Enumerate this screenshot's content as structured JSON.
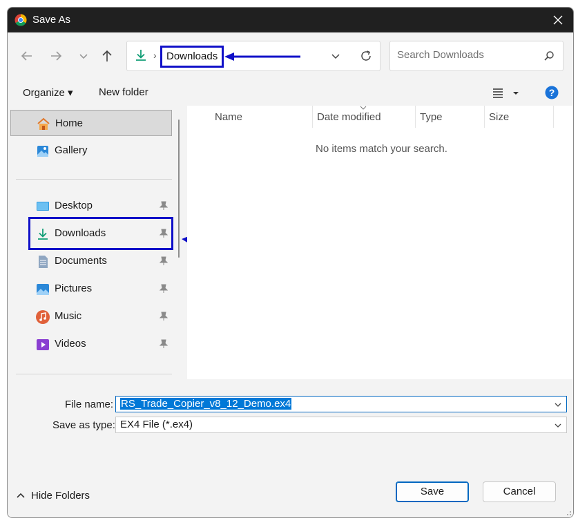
{
  "titlebar": {
    "title": "Save As",
    "app_icon": "chrome-logo",
    "close_icon": "close-icon"
  },
  "nav": {
    "back_icon": "back-arrow-icon",
    "forward_icon": "forward-arrow-icon",
    "recent_icon": "chevron-down-icon",
    "up_icon": "up-arrow-icon"
  },
  "address": {
    "location_icon": "download-icon",
    "separator": "›",
    "crumb": "Downloads",
    "dropdown_icon": "chevron-down-icon",
    "refresh_icon": "refresh-icon"
  },
  "search": {
    "placeholder": "Search Downloads",
    "icon": "search-icon"
  },
  "toolbar": {
    "organize": "Organize ▾",
    "new_folder": "New folder",
    "view_icon": "view-options-icon",
    "help_icon": "help-icon"
  },
  "sidebar": {
    "items": [
      {
        "label": "Home",
        "icon": "home-icon",
        "pinned": false,
        "selected": true
      },
      {
        "label": "Gallery",
        "icon": "gallery-icon",
        "pinned": false
      },
      {
        "label": "Desktop",
        "icon": "desktop-icon",
        "pinned": true
      },
      {
        "label": "Downloads",
        "icon": "download-icon",
        "pinned": true
      },
      {
        "label": "Documents",
        "icon": "documents-icon",
        "pinned": true
      },
      {
        "label": "Pictures",
        "icon": "pictures-icon",
        "pinned": true
      },
      {
        "label": "Music",
        "icon": "music-icon",
        "pinned": true
      },
      {
        "label": "Videos",
        "icon": "videos-icon",
        "pinned": true
      }
    ]
  },
  "list": {
    "columns": [
      "Name",
      "Date modified",
      "Type",
      "Size"
    ],
    "empty_message": "No items match your search."
  },
  "fields": {
    "file_name_label": "File name:",
    "file_name_value": "RS_Trade_Copier_v8_12_Demo.ex4",
    "save_type_label": "Save as type:",
    "save_type_value": "EX4 File (*.ex4)"
  },
  "footer": {
    "hide_folders": "Hide Folders",
    "save": "Save",
    "cancel": "Cancel"
  },
  "colors": {
    "annotation": "#1010c8",
    "accent": "#0067c0",
    "titlebar": "#202020",
    "selection": "#0078d7"
  }
}
